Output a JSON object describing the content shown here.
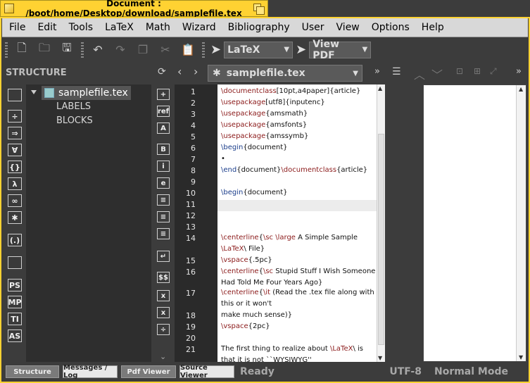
{
  "window": {
    "title": "Document : /boot/home/Desktop/download/samplefile.tex"
  },
  "menu": [
    "File",
    "Edit",
    "Tools",
    "LaTeX",
    "Math",
    "Wizard",
    "Bibliography",
    "User",
    "View",
    "Options",
    "Help"
  ],
  "toolbar": {
    "compiler": "LaTeX",
    "viewer": "View PDF"
  },
  "structure": {
    "header": "STRUCTURE",
    "root": "samplefile.tex",
    "children": [
      "LABELS",
      "BLOCKS"
    ],
    "icons": [
      "list-icon",
      "divide-icon",
      "implies-icon",
      "forall-icon",
      "braces-icon",
      "lambda-icon",
      "infinity-icon",
      "asterisk-icon",
      "delimiters-icon",
      "user-icon",
      "ps-icon",
      "mp-icon",
      "ti-icon",
      "as-icon"
    ],
    "icon_labels": [
      "",
      "÷",
      "⇒",
      "∀",
      "{}",
      "λ",
      "∞",
      "✱",
      "(.)",
      "",
      "PS",
      "MP",
      "TI",
      "AS"
    ]
  },
  "format_icons": {
    "labels": [
      "+",
      "ref",
      "A",
      "B",
      "i",
      "e",
      "≡",
      "≡",
      "≡",
      "↵",
      "$$",
      "x",
      "x",
      "÷"
    ]
  },
  "editor": {
    "filename": "samplefile.tex",
    "lines": [
      {
        "n": "1",
        "text": "\\documentclass[10pt,a4paper]{article}"
      },
      {
        "n": "2",
        "text": "\\usepackage[utf8]{inputenc}"
      },
      {
        "n": "3",
        "text": "\\usepackage{amsmath}"
      },
      {
        "n": "4",
        "text": "\\usepackage{amsfonts}"
      },
      {
        "n": "5",
        "text": "\\usepackage{amssymb}"
      },
      {
        "n": "6",
        "text": "\\begin{document}"
      },
      {
        "n": "7",
        "text": "•"
      },
      {
        "n": "8",
        "text": "\\end{document}\\documentclass{article}"
      },
      {
        "n": "9",
        "text": ""
      },
      {
        "n": "10",
        "text": "\\begin{document}"
      },
      {
        "n": "11",
        "text": ""
      },
      {
        "n": "12",
        "text": ""
      },
      {
        "n": "13",
        "text": ""
      },
      {
        "n": "14",
        "text": "\\centerline{\\sc \\large A Simple Sample"
      },
      {
        "n": "",
        "text": "\\LaTeX\\ File}"
      },
      {
        "n": "15",
        "text": "\\vspace{.5pc}"
      },
      {
        "n": "16",
        "text": "\\centerline{\\sc Stupid Stuff I Wish Someone"
      },
      {
        "n": "",
        "text": "Had Told Me Four Years Ago}"
      },
      {
        "n": "17",
        "text": "\\centerline{\\it (Read the .tex file along with"
      },
      {
        "n": "",
        "text": "this or it won't"
      },
      {
        "n": "18",
        "text": "        make much sense)}"
      },
      {
        "n": "19",
        "text": "\\vspace{2pc}"
      },
      {
        "n": "20",
        "text": ""
      },
      {
        "n": "21",
        "text": "The first thing to realize about \\LaTeX\\ is"
      },
      {
        "n": "",
        "text": "that it is not ``WYSIWYG''"
      }
    ]
  },
  "status": {
    "buttons": [
      "Structure",
      "Messages / Log",
      "Pdf Viewer",
      "Source Viewer"
    ],
    "state": "Ready",
    "encoding": "UTF-8",
    "mode": "Normal Mode"
  }
}
